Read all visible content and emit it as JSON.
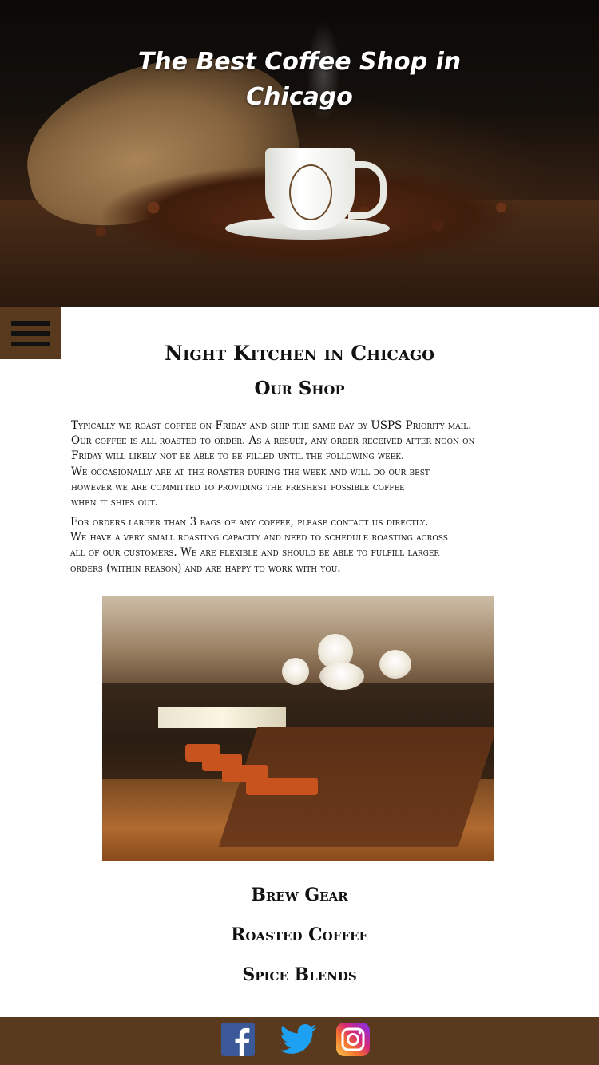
{
  "hero": {
    "title_line1": "The Best Coffee Shop in",
    "title_line2": "Chicago",
    "image": "coffee-cup-with-beans-image"
  },
  "nav": {
    "menu_icon": "hamburger-menu-icon"
  },
  "main": {
    "heading": "Night Kitchen in Chicago",
    "subheading": "Our Shop",
    "paragraph1": [
      "Typically we roast coffee on Friday and ship the same day by USPS Priority mail.",
      "Our coffee is all roasted to order. As a result, any order received after noon on",
      "Friday will likely not be able to be filled until the following week.",
      "We occasionally are at the roaster during the week and will do our best",
      "however we are committed to providing the freshest possible coffee",
      "when it ships out."
    ],
    "paragraph2": [
      "For orders larger than 3 bags of any coffee, please contact us directly.",
      "We have a very small roasting capacity and need to schedule roasting across",
      "all of our customers. We are flexible and should be able to fulfill larger",
      "orders (within reason) and are happy to work with you."
    ],
    "photo": "shop-interior-photo"
  },
  "links": {
    "brew_gear": "Brew Gear",
    "roasted_coffee": "Roasted Coffee",
    "spice_blends": "Spice Blends"
  },
  "footer": {
    "icons": [
      "facebook-icon",
      "twitter-icon",
      "instagram-icon"
    ],
    "colors": {
      "bar": "#5a3a1e",
      "facebook": "#3b5998",
      "twitter": "#1da1f2"
    }
  }
}
